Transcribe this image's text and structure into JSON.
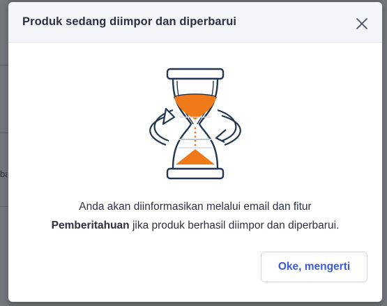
{
  "background": {
    "fragment_text": "ba"
  },
  "modal": {
    "title": "Produk sedang diimpor dan diperbarui",
    "close_icon": "close-icon",
    "illustration_icon": "hourglass-sync-icon",
    "message": {
      "line1": "Anda akan diinformasikan melalui email dan fitur",
      "line2_bold": "Pemberitahuan",
      "line2_rest": " jika produk berhasil diimpor dan diperbarui."
    },
    "confirm_label": "Oke, mengerti"
  },
  "colors": {
    "accent": "#3c5bd8",
    "sand": "#f07a1a",
    "outline": "#22364f",
    "header_bg": "#f3f5f8"
  }
}
